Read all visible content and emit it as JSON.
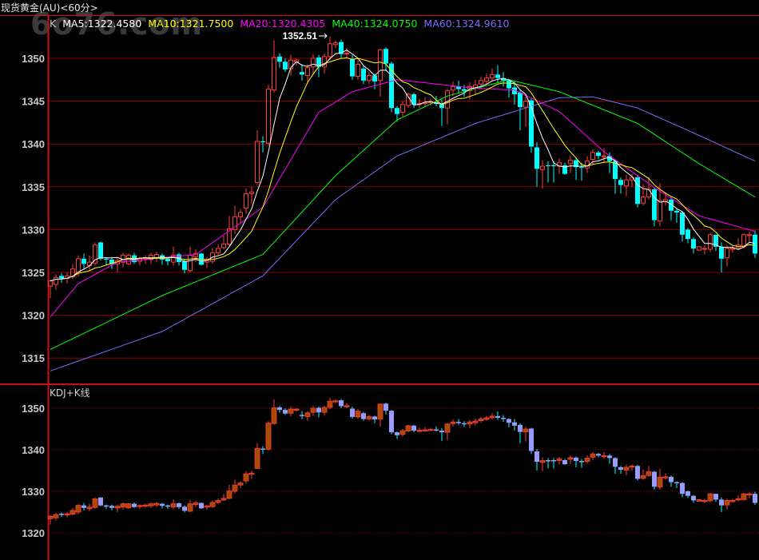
{
  "title": "现货黄金(AU)<60分>",
  "watermark": "6o76.com",
  "legend": {
    "k_label": "K",
    "items": [
      {
        "text": "MA5:1322.4580",
        "color": "#ffffff"
      },
      {
        "text": "MA10:1321.7500",
        "color": "#ffff00"
      },
      {
        "text": "MA20:1320.4305",
        "color": "#ff00ff"
      },
      {
        "text": "MA40:1324.0750",
        "color": "#00ff00"
      },
      {
        "text": "MA60:1324.9610",
        "color": "#7070ff"
      }
    ]
  },
  "lower_panel_label": "KDJ+K线",
  "high_annotation": "1352.51",
  "colors": {
    "up": "#ff3b3b",
    "down": "#00ffff",
    "grid": "#8b0000",
    "axis": "#cc1010",
    "lower_up_fill": "#a84a00",
    "lower_down_fill": "#9a9aff"
  },
  "chart_data": {
    "type": "candlestick",
    "interval": "60分",
    "upper_panel": {
      "ylim": [
        1312,
        1353.5
      ],
      "yticks": [
        1315,
        1320,
        1325,
        1330,
        1335,
        1340,
        1345,
        1350
      ],
      "ytick_labels": [
        "1315",
        "1320",
        "1325",
        "1330",
        "1335",
        "1340",
        "1345",
        "1350"
      ]
    },
    "lower_panel": {
      "ylim": [
        1313,
        1352
      ],
      "yticks": [
        1320,
        1330,
        1340,
        1350
      ],
      "ytick_labels": [
        "1320",
        "1330",
        "1340",
        "1350"
      ]
    },
    "ohlc": [
      [
        1323.4,
        1324.2,
        1322.0,
        1324.0
      ],
      [
        1323.6,
        1324.8,
        1323.0,
        1324.4
      ],
      [
        1324.6,
        1324.9,
        1323.8,
        1324.3
      ],
      [
        1324.3,
        1325.0,
        1323.7,
        1324.6
      ],
      [
        1324.5,
        1326.0,
        1324.2,
        1325.4
      ],
      [
        1325.0,
        1327.0,
        1324.5,
        1326.6
      ],
      [
        1326.6,
        1327.2,
        1325.4,
        1326.0
      ],
      [
        1325.8,
        1327.0,
        1325.2,
        1326.2
      ],
      [
        1326.1,
        1328.5,
        1325.8,
        1328.2
      ],
      [
        1328.5,
        1328.6,
        1326.4,
        1326.6
      ],
      [
        1326.6,
        1326.8,
        1325.8,
        1326.5
      ],
      [
        1326.5,
        1326.8,
        1325.4,
        1326.0
      ],
      [
        1326.0,
        1326.8,
        1325.0,
        1326.4
      ],
      [
        1326.2,
        1327.3,
        1325.6,
        1327.0
      ],
      [
        1326.0,
        1327.2,
        1325.8,
        1327.0
      ],
      [
        1327.0,
        1327.3,
        1326.0,
        1326.2
      ],
      [
        1326.3,
        1326.8,
        1325.8,
        1326.6
      ],
      [
        1326.6,
        1327.0,
        1326.0,
        1326.7
      ],
      [
        1326.5,
        1327.3,
        1326.0,
        1327.0
      ],
      [
        1326.7,
        1327.4,
        1326.2,
        1327.1
      ],
      [
        1327.0,
        1327.2,
        1325.9,
        1326.5
      ],
      [
        1326.6,
        1326.8,
        1325.8,
        1326.3
      ],
      [
        1326.2,
        1328.0,
        1325.8,
        1327.0
      ],
      [
        1327.1,
        1327.3,
        1325.8,
        1326.2
      ],
      [
        1326.3,
        1326.6,
        1324.9,
        1325.3
      ],
      [
        1325.2,
        1328.0,
        1325.0,
        1327.0
      ],
      [
        1326.8,
        1327.7,
        1326.2,
        1327.2
      ],
      [
        1327.2,
        1327.3,
        1325.8,
        1325.9
      ],
      [
        1326.2,
        1326.8,
        1325.5,
        1326.5
      ],
      [
        1326.3,
        1327.8,
        1326.0,
        1327.3
      ],
      [
        1327.3,
        1328.3,
        1327.0,
        1327.8
      ],
      [
        1327.9,
        1329.3,
        1327.7,
        1328.3
      ],
      [
        1328.3,
        1331.6,
        1328.1,
        1330.1
      ],
      [
        1330.0,
        1332.8,
        1329.5,
        1331.5
      ],
      [
        1331.5,
        1332.4,
        1330.8,
        1332.0
      ],
      [
        1332.5,
        1334.8,
        1331.8,
        1334.2
      ],
      [
        1334.2,
        1335.0,
        1333.0,
        1334.4
      ],
      [
        1335.5,
        1341.6,
        1335.3,
        1340.3
      ],
      [
        1340.3,
        1340.9,
        1339.0,
        1340.2
      ],
      [
        1340.1,
        1346.9,
        1339.8,
        1346.4
      ],
      [
        1346.3,
        1352.1,
        1346.0,
        1350.1
      ],
      [
        1350.2,
        1350.6,
        1348.9,
        1349.6
      ],
      [
        1349.6,
        1350.0,
        1348.4,
        1348.7
      ],
      [
        1348.8,
        1350.4,
        1348.0,
        1349.8
      ],
      [
        1349.6,
        1350.0,
        1349.2,
        1349.8
      ],
      [
        1348.4,
        1349.3,
        1347.4,
        1348.1
      ],
      [
        1348.0,
        1349.3,
        1347.0,
        1348.9
      ],
      [
        1349.0,
        1350.5,
        1348.2,
        1350.0
      ],
      [
        1350.1,
        1350.4,
        1347.8,
        1349.0
      ],
      [
        1349.0,
        1350.6,
        1348.2,
        1350.2
      ],
      [
        1350.2,
        1352.51,
        1349.8,
        1351.7
      ],
      [
        1351.6,
        1352.1,
        1351.2,
        1351.8
      ],
      [
        1351.9,
        1352.2,
        1350.0,
        1350.5
      ],
      [
        1350.5,
        1351.2,
        1350.0,
        1350.6
      ],
      [
        1349.9,
        1350.4,
        1347.5,
        1347.9
      ],
      [
        1347.9,
        1349.8,
        1347.5,
        1349.3
      ],
      [
        1348.8,
        1349.1,
        1347.0,
        1347.4
      ],
      [
        1347.4,
        1348.4,
        1347.0,
        1348.0
      ],
      [
        1348.0,
        1348.2,
        1346.4,
        1347.3
      ],
      [
        1347.4,
        1351.1,
        1345.5,
        1351.0
      ],
      [
        1351.1,
        1351.3,
        1348.5,
        1349.4
      ],
      [
        1349.4,
        1349.6,
        1343.7,
        1344.2
      ],
      [
        1344.2,
        1344.4,
        1342.6,
        1343.5
      ],
      [
        1343.7,
        1345.0,
        1343.2,
        1344.6
      ],
      [
        1344.5,
        1346.0,
        1344.2,
        1345.8
      ],
      [
        1345.8,
        1346.0,
        1344.2,
        1344.6
      ],
      [
        1344.6,
        1345.3,
        1344.2,
        1344.7
      ],
      [
        1344.7,
        1345.5,
        1344.3,
        1344.8
      ],
      [
        1344.8,
        1345.3,
        1344.5,
        1344.9
      ],
      [
        1344.9,
        1345.6,
        1344.4,
        1344.7
      ],
      [
        1344.6,
        1345.2,
        1342.1,
        1344.2
      ],
      [
        1344.2,
        1346.5,
        1342.3,
        1346.2
      ],
      [
        1346.3,
        1347.3,
        1345.6,
        1346.7
      ],
      [
        1346.7,
        1347.4,
        1346.0,
        1346.4
      ],
      [
        1346.4,
        1346.9,
        1345.5,
        1346.2
      ],
      [
        1346.2,
        1347.2,
        1345.2,
        1346.7
      ],
      [
        1346.5,
        1347.5,
        1345.8,
        1346.9
      ],
      [
        1347.0,
        1347.9,
        1346.5,
        1347.4
      ],
      [
        1347.3,
        1348.2,
        1347.0,
        1347.7
      ],
      [
        1347.7,
        1348.8,
        1347.3,
        1348.1
      ],
      [
        1348.1,
        1349.2,
        1347.2,
        1347.7
      ],
      [
        1347.7,
        1348.4,
        1346.7,
        1347.4
      ],
      [
        1347.4,
        1347.6,
        1345.4,
        1346.5
      ],
      [
        1346.6,
        1347.4,
        1344.6,
        1345.8
      ],
      [
        1346.0,
        1346.4,
        1341.6,
        1344.3
      ],
      [
        1344.3,
        1345.5,
        1342.0,
        1345.0
      ],
      [
        1345.1,
        1345.3,
        1339.0,
        1339.7
      ],
      [
        1339.6,
        1340.2,
        1335.0,
        1337.1
      ],
      [
        1337.0,
        1338.1,
        1334.8,
        1337.4
      ],
      [
        1337.5,
        1338.0,
        1335.5,
        1337.4
      ],
      [
        1337.5,
        1338.0,
        1335.5,
        1337.4
      ],
      [
        1337.4,
        1338.3,
        1336.5,
        1337.8
      ],
      [
        1337.5,
        1337.8,
        1336.4,
        1336.5
      ],
      [
        1337.7,
        1338.6,
        1336.6,
        1338.1
      ],
      [
        1338.1,
        1338.4,
        1335.8,
        1337.3
      ],
      [
        1337.3,
        1337.8,
        1335.7,
        1337.2
      ],
      [
        1337.2,
        1338.6,
        1336.6,
        1338.0
      ],
      [
        1338.2,
        1339.4,
        1337.5,
        1339.0
      ],
      [
        1339.0,
        1339.2,
        1338.2,
        1338.6
      ],
      [
        1338.6,
        1339.5,
        1337.8,
        1338.6
      ],
      [
        1338.6,
        1339.0,
        1336.6,
        1338.0
      ],
      [
        1338.0,
        1338.2,
        1334.2,
        1335.9
      ],
      [
        1335.8,
        1336.1,
        1334.2,
        1335.2
      ],
      [
        1335.1,
        1336.4,
        1333.9,
        1335.8
      ],
      [
        1335.8,
        1336.5,
        1335.0,
        1336.1
      ],
      [
        1336.1,
        1336.4,
        1332.6,
        1333.0
      ],
      [
        1333.1,
        1335.3,
        1332.8,
        1333.8
      ],
      [
        1333.8,
        1336.1,
        1333.5,
        1334.7
      ],
      [
        1334.7,
        1334.9,
        1330.4,
        1331.1
      ],
      [
        1331.0,
        1335.4,
        1330.4,
        1333.4
      ],
      [
        1333.3,
        1334.3,
        1332.8,
        1333.5
      ],
      [
        1333.5,
        1333.8,
        1331.1,
        1332.2
      ],
      [
        1332.2,
        1332.4,
        1330.8,
        1332.0
      ],
      [
        1332.0,
        1332.2,
        1328.6,
        1329.4
      ],
      [
        1330.0,
        1330.2,
        1328.4,
        1328.9
      ],
      [
        1328.9,
        1329.1,
        1327.2,
        1327.8
      ],
      [
        1327.6,
        1328.0,
        1327.5,
        1328.0
      ],
      [
        1327.8,
        1328.2,
        1327.1,
        1327.8
      ],
      [
        1327.7,
        1329.6,
        1327.4,
        1329.4
      ],
      [
        1329.4,
        1329.4,
        1327.5,
        1328.0
      ],
      [
        1328.0,
        1328.5,
        1325.0,
        1326.6
      ],
      [
        1326.7,
        1328.2,
        1325.7,
        1327.8
      ],
      [
        1327.7,
        1328.2,
        1327.3,
        1327.8
      ],
      [
        1327.9,
        1329.0,
        1327.6,
        1328.2
      ],
      [
        1328.0,
        1329.6,
        1327.8,
        1329.4
      ],
      [
        1329.3,
        1329.8,
        1328.4,
        1329.4
      ],
      [
        1329.4,
        1329.9,
        1326.7,
        1327.2
      ]
    ],
    "moving_averages": {
      "MA5": {
        "computed_from": "close",
        "period": 5
      },
      "MA10": {
        "computed_from": "close",
        "period": 10
      },
      "MA20": {
        "points": [
          [
            1,
            1319.8
          ],
          [
            6,
            1323.7
          ],
          [
            13,
            1326.2
          ],
          [
            27,
            1327.1
          ],
          [
            39,
            1332.6
          ],
          [
            49,
            1343.7
          ],
          [
            55,
            1346.1
          ],
          [
            63,
            1347.5
          ],
          [
            77,
            1346.5
          ],
          [
            84,
            1346.3
          ],
          [
            92,
            1343.8
          ],
          [
            100,
            1339.1
          ],
          [
            109,
            1334.9
          ],
          [
            117,
            1331.6
          ],
          [
            127,
            1329.8
          ]
        ]
      },
      "MA40": {
        "points": [
          [
            1,
            1316.0
          ],
          [
            21,
            1322.3
          ],
          [
            39,
            1327.1
          ],
          [
            52,
            1336.3
          ],
          [
            63,
            1342.8
          ],
          [
            72,
            1345.6
          ],
          [
            83,
            1347.5
          ],
          [
            92,
            1346.1
          ],
          [
            106,
            1342.4
          ],
          [
            117,
            1337.7
          ],
          [
            127,
            1333.8
          ]
        ]
      },
      "MA60": {
        "points": [
          [
            1,
            1313.5
          ],
          [
            21,
            1318.1
          ],
          [
            39,
            1324.6
          ],
          [
            52,
            1333.5
          ],
          [
            63,
            1338.6
          ],
          [
            77,
            1342.4
          ],
          [
            92,
            1345.4
          ],
          [
            98,
            1345.5
          ],
          [
            106,
            1344.2
          ],
          [
            117,
            1341.0
          ],
          [
            127,
            1338.0
          ]
        ]
      }
    }
  }
}
